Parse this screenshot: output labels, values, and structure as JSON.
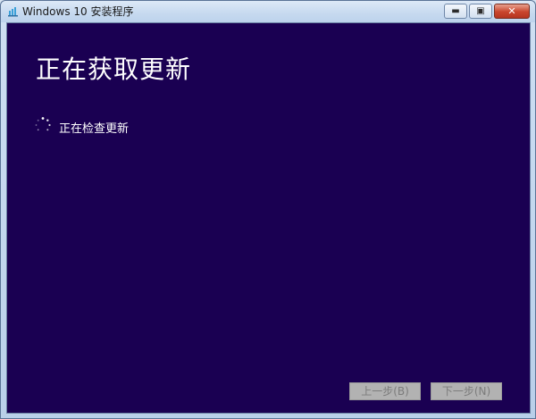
{
  "window": {
    "title": "Windows 10 安装程序",
    "buttons": {
      "minimize": "▬",
      "maximize": "▣",
      "close": "✕"
    }
  },
  "main": {
    "heading": "正在获取更新",
    "status": "正在检查更新"
  },
  "footer": {
    "back_label": "上一步(B)",
    "next_label": "下一步(N)"
  },
  "icons": {
    "app": "setup-icon",
    "spinner": "loading-spinner-icon"
  },
  "colors": {
    "background": "#1a0052",
    "text": "#ffffff",
    "disabled_button": "#b2b2b2"
  }
}
